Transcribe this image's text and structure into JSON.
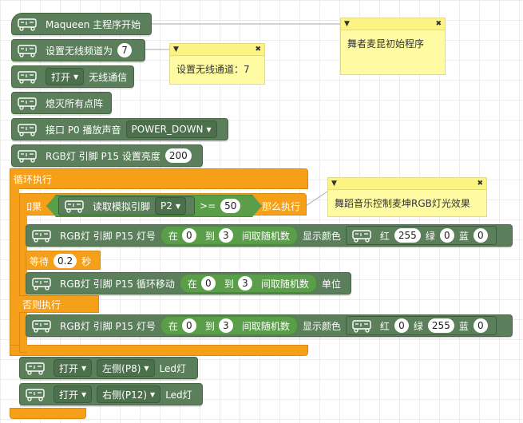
{
  "blocks": {
    "start": "Maqueen 主程序开始",
    "set_channel": "设置无线频道为",
    "channel_value": "7",
    "open_label": "打开",
    "wireless": "无线通信",
    "clear_leds": "熄灭所有点阵",
    "port_play": "接口 P0 播放声音",
    "sound": "POWER_DOWN",
    "rgb_brightness": "RGB灯 引脚 P15 设置亮度",
    "brightness_value": "200",
    "loop": "循环执行",
    "if": "如果",
    "read_analog": "读取模拟引脚",
    "pin": "P2",
    "cmp": ">=",
    "threshold": "50",
    "then": "那么执行",
    "rgb_led_num": "RGB灯 引脚 P15 灯号",
    "at": "在",
    "zero": "0",
    "to": "到",
    "three": "3",
    "random": "间取随机数",
    "show_color": "显示颜色",
    "red": "红",
    "green": "绿",
    "blue": "蓝",
    "r1": "255",
    "g1": "0",
    "b1": "0",
    "wait": "等待",
    "wait_value": "0.2",
    "seconds": "秒",
    "rgb_shift": "RGB灯 引脚 P15 循环移动",
    "unit": "单位",
    "else": "否则执行",
    "r2": "0",
    "g2": "255",
    "b2": "0",
    "open1": "打开",
    "left": "左侧(P8)",
    "led": "Led灯",
    "open2": "打开",
    "right": "右侧(P12)"
  },
  "comments": {
    "c1": "舞者麦昆初始程序",
    "c2": "设置无线通道：7",
    "c3": "舞蹈音乐控制麦坤RGB灯光效果"
  },
  "colors": {
    "block_green": "#5b7f5b",
    "loop_orange": "#f6a019",
    "logic_green": "#5a9e4a",
    "note_yellow": "#fffba3"
  }
}
